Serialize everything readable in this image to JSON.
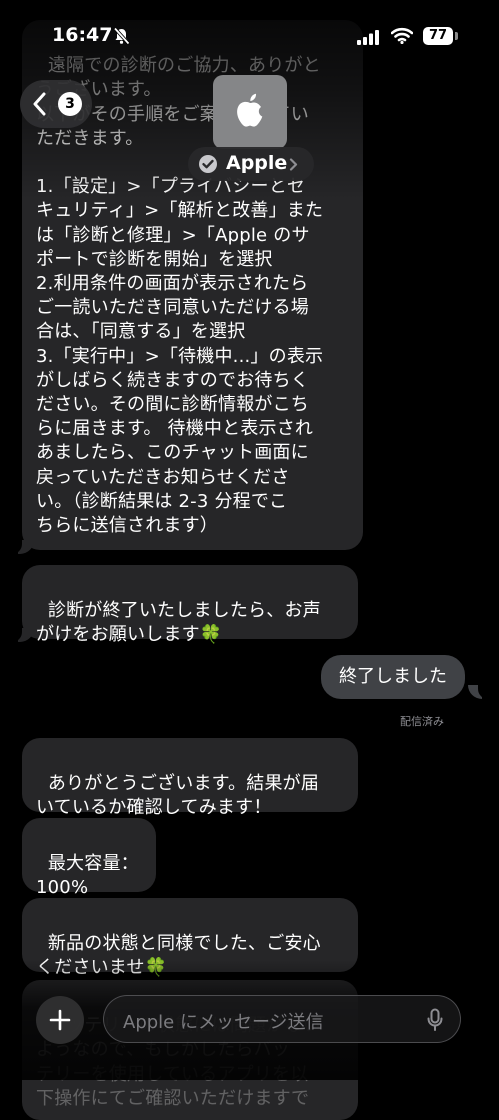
{
  "status_bar": {
    "time": "16:47",
    "battery": "77"
  },
  "header": {
    "back_count": "3",
    "contact_name": "Apple",
    "contact_avatar_icon": "apple-logo-icon"
  },
  "messages": [
    {
      "from": "them",
      "text": "遠隔での診断のご協力、ありがと\nうございます。\n以下がその手順をご案内させてい\nただきます。\n\n1.「設定」>「プライバシーとセ\nキュリティ」>「解析と改善」また\nは「診断と修理」>「Apple のサ\nポートで診断を開始」を選択\n2.利用条件の画面が表示されたら\nご一読いただき同意いただける場\n合は、「同意する」を選択\n3.「実行中」>「待機中...」の表示\nがしばらく続きますのでお待ちく\nださい。その間に診断情報がこち\nらに届きます。 待機中と表示され\nあましたら、このチャット画面に\n戻っていただきお知らせくださ\nい。（診断結果は 2-3 分程でこ\nちらに送信されます）"
    },
    {
      "from": "them",
      "text": "診断が終了いたしましたら、お声\nがけをお願いします🍀"
    },
    {
      "from": "me",
      "text": "終了しました",
      "status": "配信済み"
    },
    {
      "from": "them",
      "text": "ありがとうございます。結果が届\nいているか確認してみます！"
    },
    {
      "from": "them",
      "text": "最大容量：\n100%"
    },
    {
      "from": "them",
      "text": "新品の状態と同様でした、ご安心\nくださいませ🍀"
    },
    {
      "from": "them",
      "text": "バッテリーの状態には問題がない\nようなので、もしかしたらバッ\nテリーを使用しているアプリを以\n下操作にてご確認いただけますで"
    }
  ],
  "composer": {
    "placeholder": "Apple にメッセージ送信",
    "add_icon": "plus-icon",
    "mic_icon": "mic-icon"
  }
}
